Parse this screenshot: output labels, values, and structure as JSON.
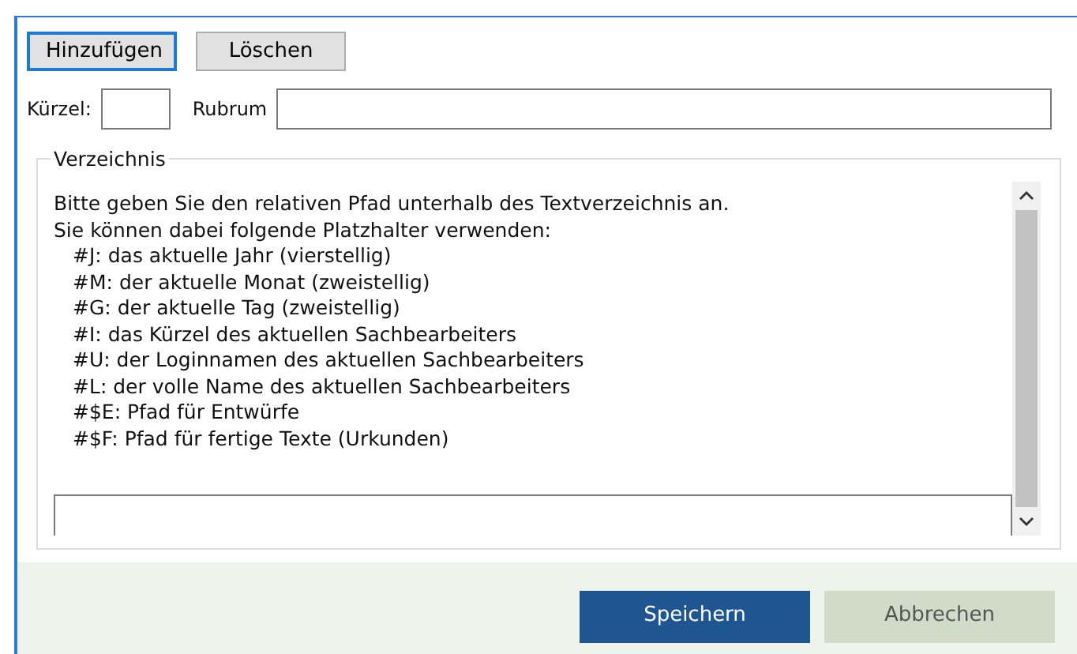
{
  "toolbar": [
    {
      "label": "Hinzufügen",
      "focused": true
    },
    {
      "label": "Löschen",
      "focused": false
    }
  ],
  "fields": {
    "kuerzel_label": "Kürzel:",
    "rubrum_label": "Rubrum"
  },
  "group": {
    "title": "Verzeichnis",
    "intro": [
      "Bitte geben Sie den relativen Pfad unterhalb des Textverzeichnis an.",
      "Sie können dabei folgende Platzhalter verwenden:"
    ],
    "placeholders": [
      "#J: das aktuelle Jahr (vierstellig)",
      "#M: der aktuelle Monat (zweistellig)",
      "#G: der aktuelle Tag (zweistellig)",
      "#I: das Kürzel des aktuellen Sachbearbeiters",
      "#U: der Loginnamen des aktuellen Sachbearbeiters",
      "#L: der volle Name des aktuellen Sachbearbeiters",
      "#$E: Pfad für Entwürfe",
      "#$F: Pfad für fertige Texte (Urkunden)"
    ]
  },
  "footer": [
    {
      "label": "Speichern",
      "kind": "primary"
    },
    {
      "label": "Abbrechen",
      "kind": "secondary"
    }
  ]
}
